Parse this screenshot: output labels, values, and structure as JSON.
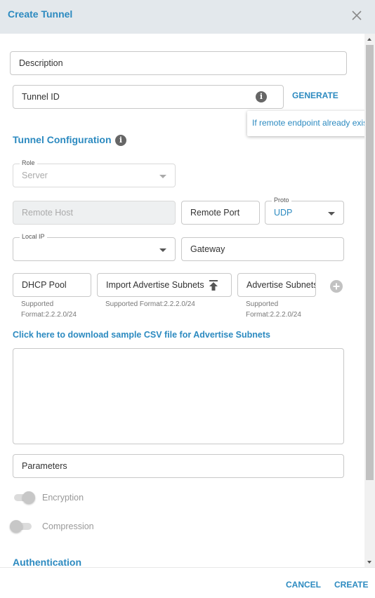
{
  "dialog": {
    "title": "Create Tunnel"
  },
  "fields": {
    "description_placeholder": "Description",
    "tunnel_id_placeholder": "Tunnel ID",
    "generate_label": "GENERATE",
    "tooltip_text": "If remote endpoint already exists",
    "role_label": "Role",
    "role_value": "Server",
    "remote_host_placeholder": "Remote Host",
    "remote_port_placeholder": "Remote Port",
    "proto_label": "Proto",
    "proto_value": "UDP",
    "local_ip_label": "Local IP",
    "local_ip_value": "",
    "gateway_placeholder": "Gateway",
    "dhcp_pool_placeholder": "DHCP Pool",
    "import_subnets_label": "Import Advertise Subnets",
    "advertise_subnets_placeholder": "Advertise Subnets",
    "dhcp_hint": "Supported Format:2.2.2.0/24",
    "import_hint": "Supported Format:2.2.2.0/24",
    "advertise_hint": "Supported Format:2.2.2.0/24",
    "download_csv_link": "Click here to download sample CSV file for Advertise Subnets",
    "subnets_textarea": "",
    "parameters_placeholder": "Parameters",
    "encryption_label": "Encryption",
    "encryption_on": true,
    "compression_label": "Compression",
    "compression_on": false
  },
  "sections": {
    "tunnel_config": "Tunnel Configuration",
    "authentication": "Authentication"
  },
  "footer": {
    "cancel_label": "CANCEL",
    "create_label": "CREATE"
  },
  "colors": {
    "accent": "#2c8ac0",
    "header_bg": "#e3e8ec"
  },
  "icons": {
    "close": "close-icon",
    "info": "info-icon",
    "upload": "upload-icon",
    "add": "add-circle-icon",
    "dropdown": "chevron-down-icon"
  }
}
